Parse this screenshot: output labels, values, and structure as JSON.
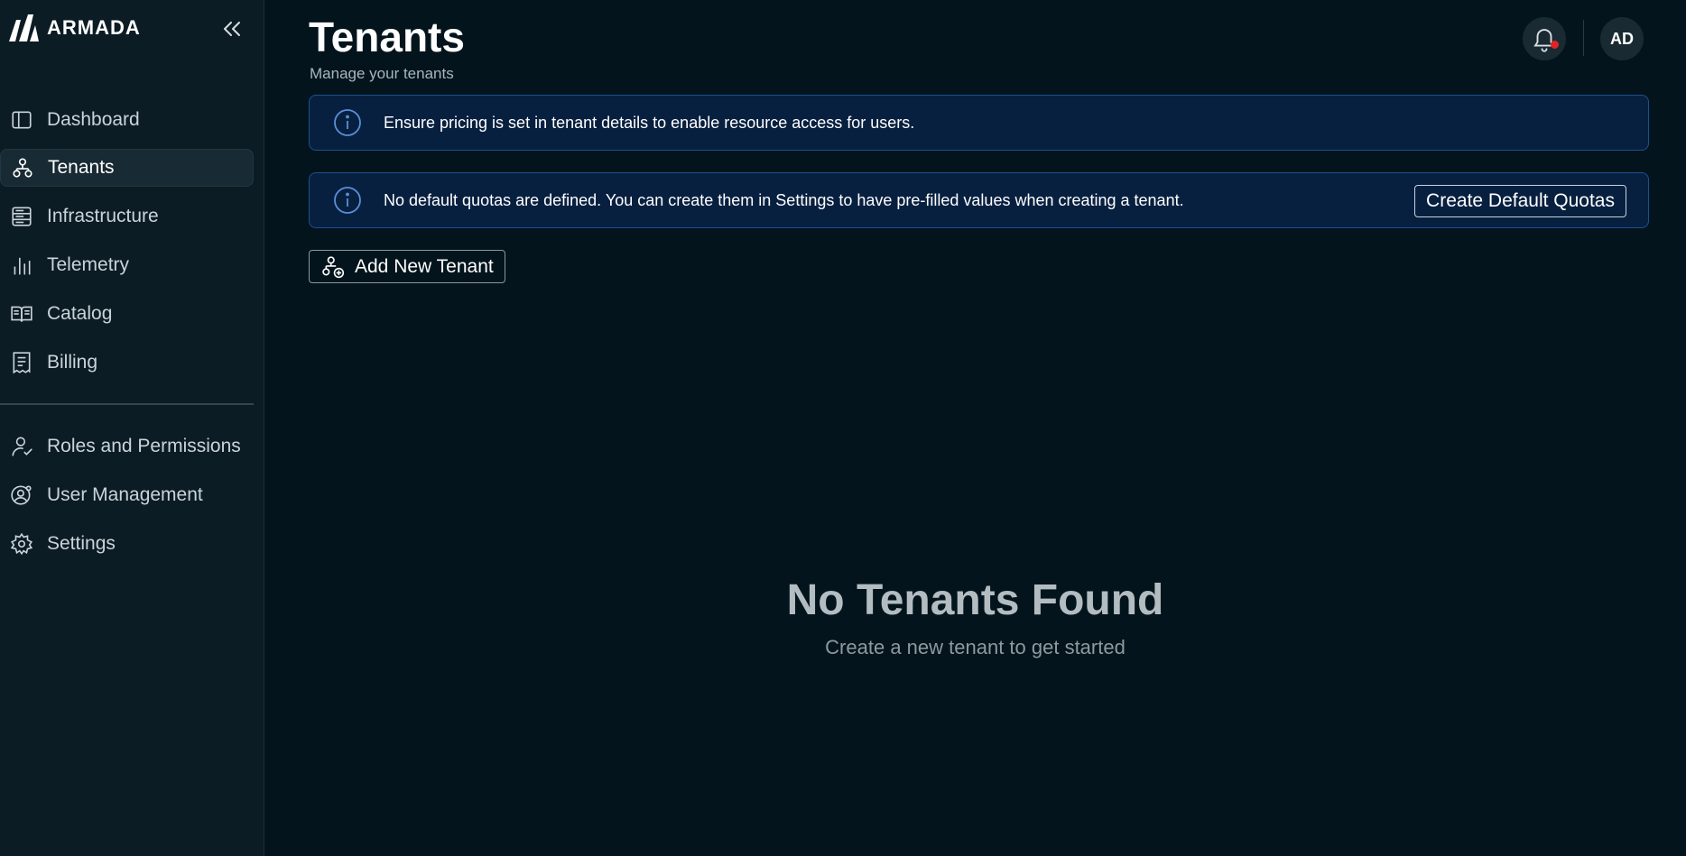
{
  "brand": {
    "name": "ARMADA"
  },
  "sidebar": {
    "items": [
      {
        "label": "Dashboard",
        "icon": "dashboard-panel-icon",
        "active": false
      },
      {
        "label": "Tenants",
        "icon": "tenants-hierarchy-icon",
        "active": true
      },
      {
        "label": "Infrastructure",
        "icon": "server-rack-icon",
        "active": false
      },
      {
        "label": "Telemetry",
        "icon": "bar-chart-icon",
        "active": false
      },
      {
        "label": "Catalog",
        "icon": "book-icon",
        "active": false
      },
      {
        "label": "Billing",
        "icon": "receipt-icon",
        "active": false
      }
    ],
    "secondary_items": [
      {
        "label": "Roles and Permissions",
        "icon": "user-check-icon"
      },
      {
        "label": "User Management",
        "icon": "user-circle-gear-icon"
      },
      {
        "label": "Settings",
        "icon": "gear-icon"
      }
    ]
  },
  "header": {
    "title": "Tenants",
    "subtitle": "Manage your tenants",
    "avatar_initials": "AD"
  },
  "alerts": [
    {
      "text": "Ensure pricing is set in tenant details to enable resource access for users."
    },
    {
      "text": "No default quotas are defined. You can create them in Settings to have pre-filled values when creating a tenant.",
      "action_label": "Create Default Quotas"
    }
  ],
  "actions": {
    "add_tenant_label": "Add New Tenant"
  },
  "empty_state": {
    "title": "No Tenants Found",
    "subtitle": "Create a new tenant to get started"
  },
  "colors": {
    "background": "#03141c",
    "sidebar": "#0c1c24",
    "alert_bg": "#082040",
    "alert_border": "#1d4f91",
    "notification_dot": "#e02424"
  }
}
